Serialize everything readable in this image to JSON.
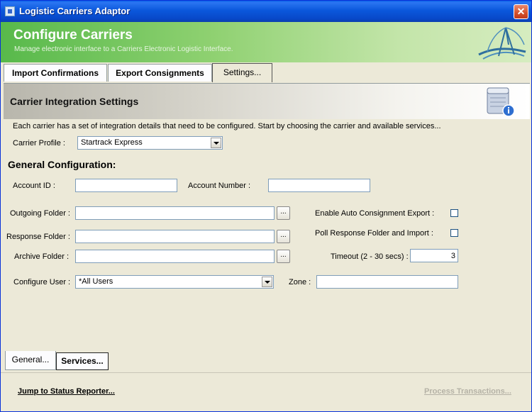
{
  "window": {
    "title": "Logistic Carriers Adaptor",
    "close_glyph": "✕"
  },
  "banner": {
    "title": "Configure Carriers",
    "subtitle": "Manage electronic interface to a Carriers Electronic Logistic Interface."
  },
  "top_tabs": [
    {
      "label": "Import Confirmations"
    },
    {
      "label": "Export Consignments"
    },
    {
      "label": "Settings..."
    }
  ],
  "panel": {
    "title": "Carrier Integration Settings",
    "description": "Each carrier has a set of integration details that need to be configured. Start by choosing the carrier and available services...",
    "carrier_profile": {
      "label": "Carrier Profile :",
      "value": "Startrack Express"
    },
    "section_title": "General Configuration:",
    "account_id": {
      "label": "Account ID :",
      "value": ""
    },
    "account_number": {
      "label": "Account Number :",
      "value": ""
    },
    "outgoing_folder": {
      "label": "Outgoing Folder :",
      "value": "",
      "browse": "..."
    },
    "response_folder": {
      "label": "Response Folder :",
      "value": "",
      "browse": "..."
    },
    "archive_folder": {
      "label": "Archive Folder :",
      "value": "",
      "browse": "..."
    },
    "auto_export": {
      "label": "Enable Auto Consignment Export :"
    },
    "poll_response": {
      "label": "Poll Response Folder and Import :"
    },
    "timeout": {
      "label": "Timeout (2 - 30 secs) :",
      "value": "3"
    },
    "configure_user": {
      "label": "Configure User :",
      "value": "*All Users"
    },
    "zone": {
      "label": "Zone :",
      "value": ""
    }
  },
  "bottom_tabs": [
    {
      "label": "General..."
    },
    {
      "label": "Services..."
    }
  ],
  "footer": {
    "status_link": "Jump to Status Reporter...",
    "process_link": "Process Transactions..."
  }
}
